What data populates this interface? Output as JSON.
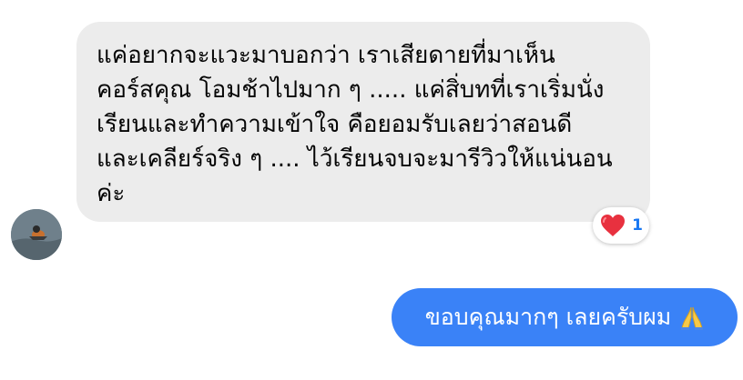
{
  "incoming_message": {
    "text": "แค่อยากจะแวะมาบอกว่า เราเสียดายที่มาเห็น\nคอร์สคุณ โอมช้าไปมาก ๆ ..... แค่สิ่บทที่เราเริ่มนั่ง\nเรียนและทำความเข้าใจ คือยอมรับเลยว่าสอนดี\nและเคลียร์จริง ๆ .... ไว้เรียนจบจะมารีวิวให้แน่นอน\nค่ะ"
  },
  "reaction": {
    "icon": "heart-icon",
    "count": "1",
    "count_color": "#1877f2"
  },
  "outgoing_message": {
    "text": "ขอบคุณมากๆ เลยครับผม",
    "emoji": "pray-icon",
    "bubble_color": "#3a82f7"
  }
}
